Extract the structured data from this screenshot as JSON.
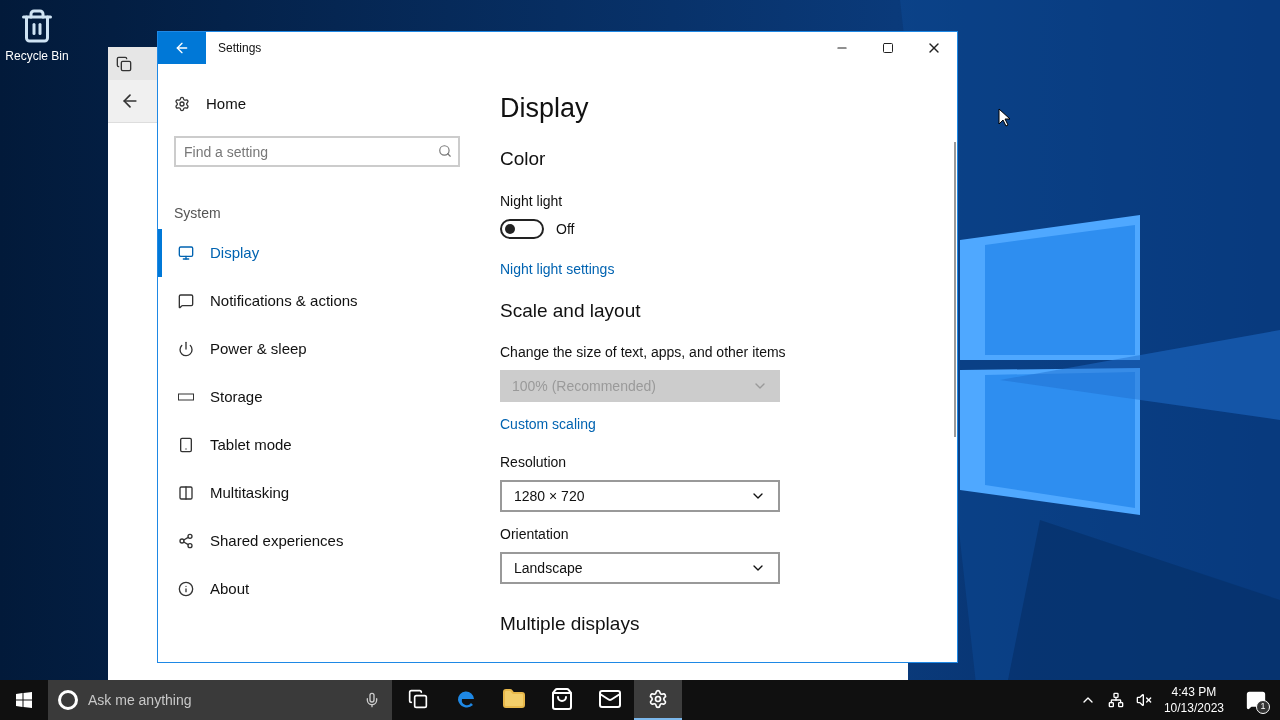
{
  "desktop_icons": [
    {
      "label": "Recycle Bin"
    }
  ],
  "settings_window": {
    "title": "Settings",
    "home": "Home",
    "search": {
      "placeholder": "Find a setting"
    },
    "section": "System",
    "sidebar": {
      "items": [
        {
          "label": "Display",
          "kind": "display",
          "selected": true
        },
        {
          "label": "Notifications & actions",
          "kind": "notifications",
          "selected": false
        },
        {
          "label": "Power & sleep",
          "kind": "power",
          "selected": false
        },
        {
          "label": "Storage",
          "kind": "storage",
          "selected": false
        },
        {
          "label": "Tablet mode",
          "kind": "tablet",
          "selected": false
        },
        {
          "label": "Multitasking",
          "kind": "multitasking",
          "selected": false
        },
        {
          "label": "Shared experiences",
          "kind": "shared",
          "selected": false
        },
        {
          "label": "About",
          "kind": "about",
          "selected": false
        }
      ]
    },
    "page_title": "Display",
    "color": {
      "heading": "Color",
      "night_light": {
        "label": "Night light",
        "on": false,
        "state_text": "Off"
      },
      "link": "Night light settings"
    },
    "scale": {
      "heading": "Scale and layout",
      "size_label": "Change the size of text, apps, and other items",
      "size_dropdown": {
        "value": "100% (Recommended)",
        "disabled": true
      },
      "link": "Custom scaling",
      "resolution": {
        "label": "Resolution",
        "value": "1280 × 720",
        "disabled": false
      },
      "orientation": {
        "label": "Orientation",
        "value": "Landscape",
        "disabled": false
      }
    },
    "next_heading": "Multiple displays"
  },
  "taskbar": {
    "search": {
      "placeholder": "Ask me anything"
    },
    "apps": [
      {
        "kind": "taskview",
        "active": false
      },
      {
        "kind": "edge",
        "active": false
      },
      {
        "kind": "folder",
        "active": false
      },
      {
        "kind": "store",
        "active": false
      },
      {
        "kind": "mail",
        "active": false
      },
      {
        "kind": "settings",
        "active": true
      }
    ],
    "time": "4:43 PM",
    "date": "10/13/2023",
    "notifications": "1"
  }
}
